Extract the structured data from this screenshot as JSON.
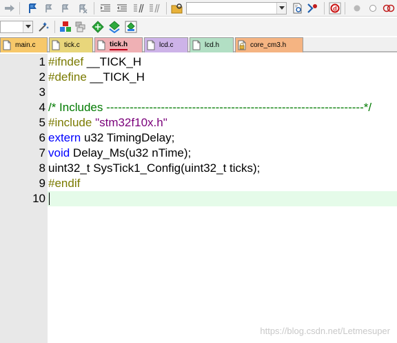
{
  "toolbar_build": {
    "target_combo_value": ""
  },
  "toolbar_project": {
    "target_select_value": ""
  },
  "tabs": [
    {
      "label": "main.c",
      "color": "#f7c86a"
    },
    {
      "label": "tick.c",
      "color": "#e8d67b"
    },
    {
      "label": "tick.h",
      "color": "#efb0b4",
      "active": true
    },
    {
      "label": "lcd.c",
      "color": "#cdb3e8"
    },
    {
      "label": "lcd.h",
      "color": "#b2dfc4"
    },
    {
      "label": "core_cm3.h",
      "color": "#f5b482"
    }
  ],
  "editor": {
    "lines": [
      {
        "number": "1",
        "segments": [
          {
            "text": "#ifndef",
            "style": "pp"
          },
          {
            "text": " __TICK_H",
            "style": ""
          }
        ]
      },
      {
        "number": "2",
        "segments": [
          {
            "text": "#define",
            "style": "pp"
          },
          {
            "text": " __TICK_H",
            "style": ""
          }
        ]
      },
      {
        "number": "3",
        "segments": []
      },
      {
        "number": "4",
        "segments": [
          {
            "text": "/* Includes ------------------------------------------------------------------*/",
            "style": "cm"
          }
        ]
      },
      {
        "number": "5",
        "segments": [
          {
            "text": "#include",
            "style": "pp"
          },
          {
            "text": " ",
            "style": ""
          },
          {
            "text": "\"stm32f10x.h\"",
            "style": "str"
          }
        ]
      },
      {
        "number": "6",
        "segments": [
          {
            "text": "extern",
            "style": "kw"
          },
          {
            "text": " u32 TimingDelay;",
            "style": ""
          }
        ]
      },
      {
        "number": "7",
        "segments": [
          {
            "text": "void",
            "style": "kw"
          },
          {
            "text": " Delay_Ms(u32 nTime);",
            "style": ""
          }
        ]
      },
      {
        "number": "8",
        "segments": [
          {
            "text": "uint32_t SysTick1_Config(uint32_t ticks);",
            "style": ""
          }
        ]
      },
      {
        "number": "9",
        "segments": [
          {
            "text": "#endif",
            "style": "pp"
          }
        ]
      },
      {
        "number": "10",
        "segments": [],
        "current": true
      }
    ]
  },
  "watermark": "https://blog.csdn.net/Letmesuper",
  "colors": {
    "current_line": "#e5fbe9",
    "preprocessor": "#7a7a00",
    "keyword": "#0000ff",
    "string": "#7a007a",
    "comment": "#007a00"
  }
}
